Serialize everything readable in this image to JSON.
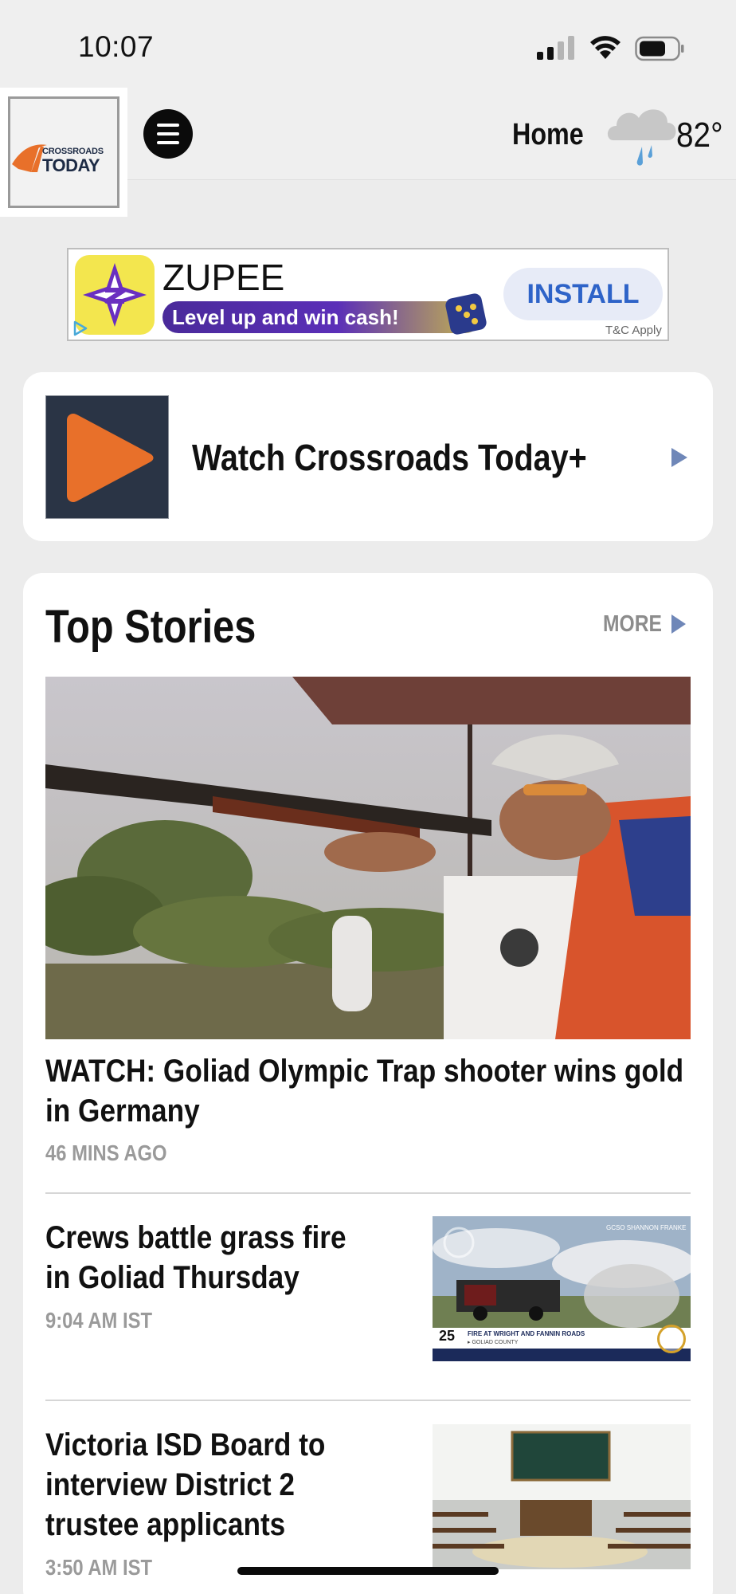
{
  "status_bar": {
    "time": "10:07"
  },
  "header": {
    "logo_line1": "CROSSROADS",
    "logo_line2": "TODAY",
    "home_label": "Home",
    "temperature": "82°",
    "weather_icon": "rain-cloud-icon"
  },
  "ad": {
    "app_name": "ZUPEE",
    "tagline": "Level up and win cash!",
    "install_label": "INSTALL",
    "terms": "T&C Apply"
  },
  "watch": {
    "label": "Watch Crossroads Today+"
  },
  "top_stories": {
    "title": "Top Stories",
    "more_label": "MORE",
    "hero": {
      "headline": "WATCH: Goliad Olympic Trap shooter wins gold in Germany",
      "time": "46 MINS AGO"
    },
    "items": [
      {
        "headline": "Crews battle grass fire in Goliad Thursday",
        "time": "9:04 AM IST",
        "thumb_credit": "GCSO SHANNON FRANKE",
        "thumb_caption": "FIRE AT WRIGHT AND FANNIN ROADS",
        "thumb_subcaption": "▸ GOLIAD COUNTY",
        "thumb_channel": "25"
      },
      {
        "headline": "Victoria ISD Board to interview District 2 trustee applicants",
        "time": "3:50 AM IST"
      }
    ]
  },
  "colors": {
    "accent_orange": "#e8702a",
    "install_blue": "#2e63c8",
    "arrow_blue": "#6f87b8"
  }
}
